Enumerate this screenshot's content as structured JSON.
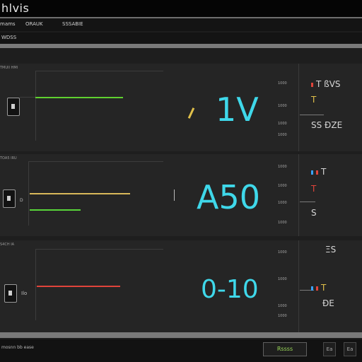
{
  "app": {
    "title": "hlvis"
  },
  "tabs": [
    {
      "label": "mams"
    },
    {
      "label": "ORAUK"
    },
    {
      "label": "SSSABIE"
    }
  ],
  "subheader": {
    "label": "WDSS"
  },
  "panels": [
    {
      "id": "panel-1",
      "header": "TMUII HMI",
      "value": "1V",
      "value_color": "#3fd8ea",
      "trace_colors": [
        "#5fd12f"
      ],
      "scale_labels": [
        "1000",
        "1000",
        "1000",
        "1000"
      ],
      "side_lines": [
        "T ßVS",
        "T",
        "SS ÐZE"
      ]
    },
    {
      "id": "panel-2",
      "header": "TOA5 IRU",
      "value": "A50",
      "value_color": "#3fd8ea",
      "trace_colors": [
        "#d8b85a",
        "#58d63a"
      ],
      "scale_labels": [
        "1000",
        "1000",
        "1000",
        "1000"
      ],
      "side_lines": [
        "T",
        "T",
        "S"
      ],
      "marker_label": "D"
    },
    {
      "id": "panel-3",
      "header": "S4CH IA",
      "value": "0-10",
      "value_color": "#3fd8ea",
      "trace_colors": [
        "#e0443a"
      ],
      "scale_labels": [
        "1000",
        "1000",
        "1000",
        "1000"
      ],
      "side_lines": [
        "ΞS",
        "T",
        "ÐE"
      ],
      "marker_label": "Ilo"
    }
  ],
  "status": {
    "text": "mosnn bb ease"
  },
  "buttons": [
    {
      "label": "Rssss"
    },
    {
      "label": "Ea"
    },
    {
      "label": "Ea"
    }
  ],
  "colors": {
    "accent": "#3fd8ea",
    "good": "#5fd12f",
    "warn": "#e0c04a",
    "alarm": "#e0443a"
  }
}
